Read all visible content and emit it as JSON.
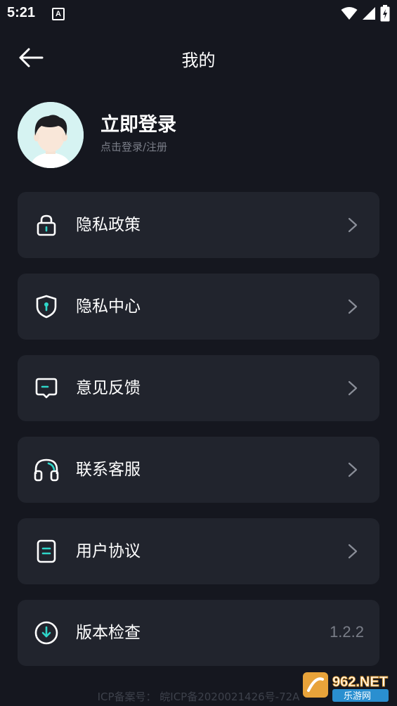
{
  "status_bar": {
    "time": "5:21",
    "notification_letter": "A"
  },
  "header": {
    "title": "我的"
  },
  "profile": {
    "title": "立即登录",
    "subtitle": "点击登录/注册"
  },
  "menu": {
    "items": [
      {
        "label": "隐私政策",
        "icon": "lock-icon"
      },
      {
        "label": "隐私中心",
        "icon": "shield-icon"
      },
      {
        "label": "意见反馈",
        "icon": "feedback-icon"
      },
      {
        "label": "联系客服",
        "icon": "headset-icon"
      },
      {
        "label": "用户协议",
        "icon": "document-icon"
      },
      {
        "label": "版本检查",
        "icon": "download-circle-icon",
        "value": "1.2.2"
      }
    ]
  },
  "footer": {
    "icp": "ICP备案号： 皖ICP备2020021426号-72A"
  },
  "watermark": {
    "text": "962.NET",
    "subtext": "乐游网"
  },
  "colors": {
    "background": "#15171f",
    "card": "#21242d",
    "accent": "#2fd6c9",
    "muted_text": "#7a7e88"
  }
}
